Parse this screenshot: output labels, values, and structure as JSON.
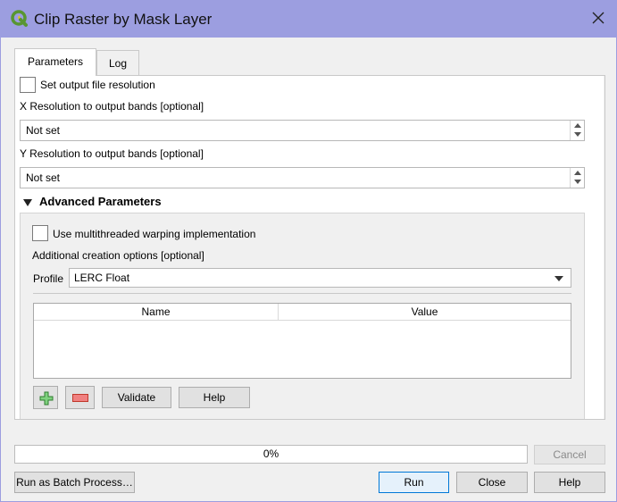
{
  "window": {
    "title": "Clip Raster by Mask Layer"
  },
  "tabs": [
    {
      "label": "Parameters"
    },
    {
      "label": "Log"
    }
  ],
  "params": {
    "set_resolution_label": "Set output file resolution",
    "x_res_label": "X Resolution to output bands [optional]",
    "x_res_value": "Not set",
    "y_res_label": "Y Resolution to output bands [optional]",
    "y_res_value": "Not set",
    "advanced_label": "Advanced Parameters",
    "multithread_label": "Use multithreaded warping implementation",
    "creation_options_label": "Additional creation options [optional]",
    "profile_label": "Profile",
    "profile_value": "LERC Float",
    "table_headers": [
      "Name",
      "Value"
    ],
    "validate_label": "Validate",
    "help_label": "Help"
  },
  "footer": {
    "progress_value": 0,
    "progress_text": "0%",
    "cancel_label": "Cancel",
    "batch_label": "Run as Batch Process…",
    "run_label": "Run",
    "close_label": "Close",
    "help_label": "Help"
  },
  "colors": {
    "titlebar": "#9c9ee0",
    "qgis_green": "#589632",
    "qgis_yellow": "#eec900",
    "add_green": "#3a9a3a",
    "remove_red": "#d9534f"
  },
  "icons": {
    "app": "qgis-logo-icon",
    "close": "close-icon",
    "expand": "triangle-down-icon",
    "add": "plus-icon",
    "remove": "minus-icon"
  }
}
